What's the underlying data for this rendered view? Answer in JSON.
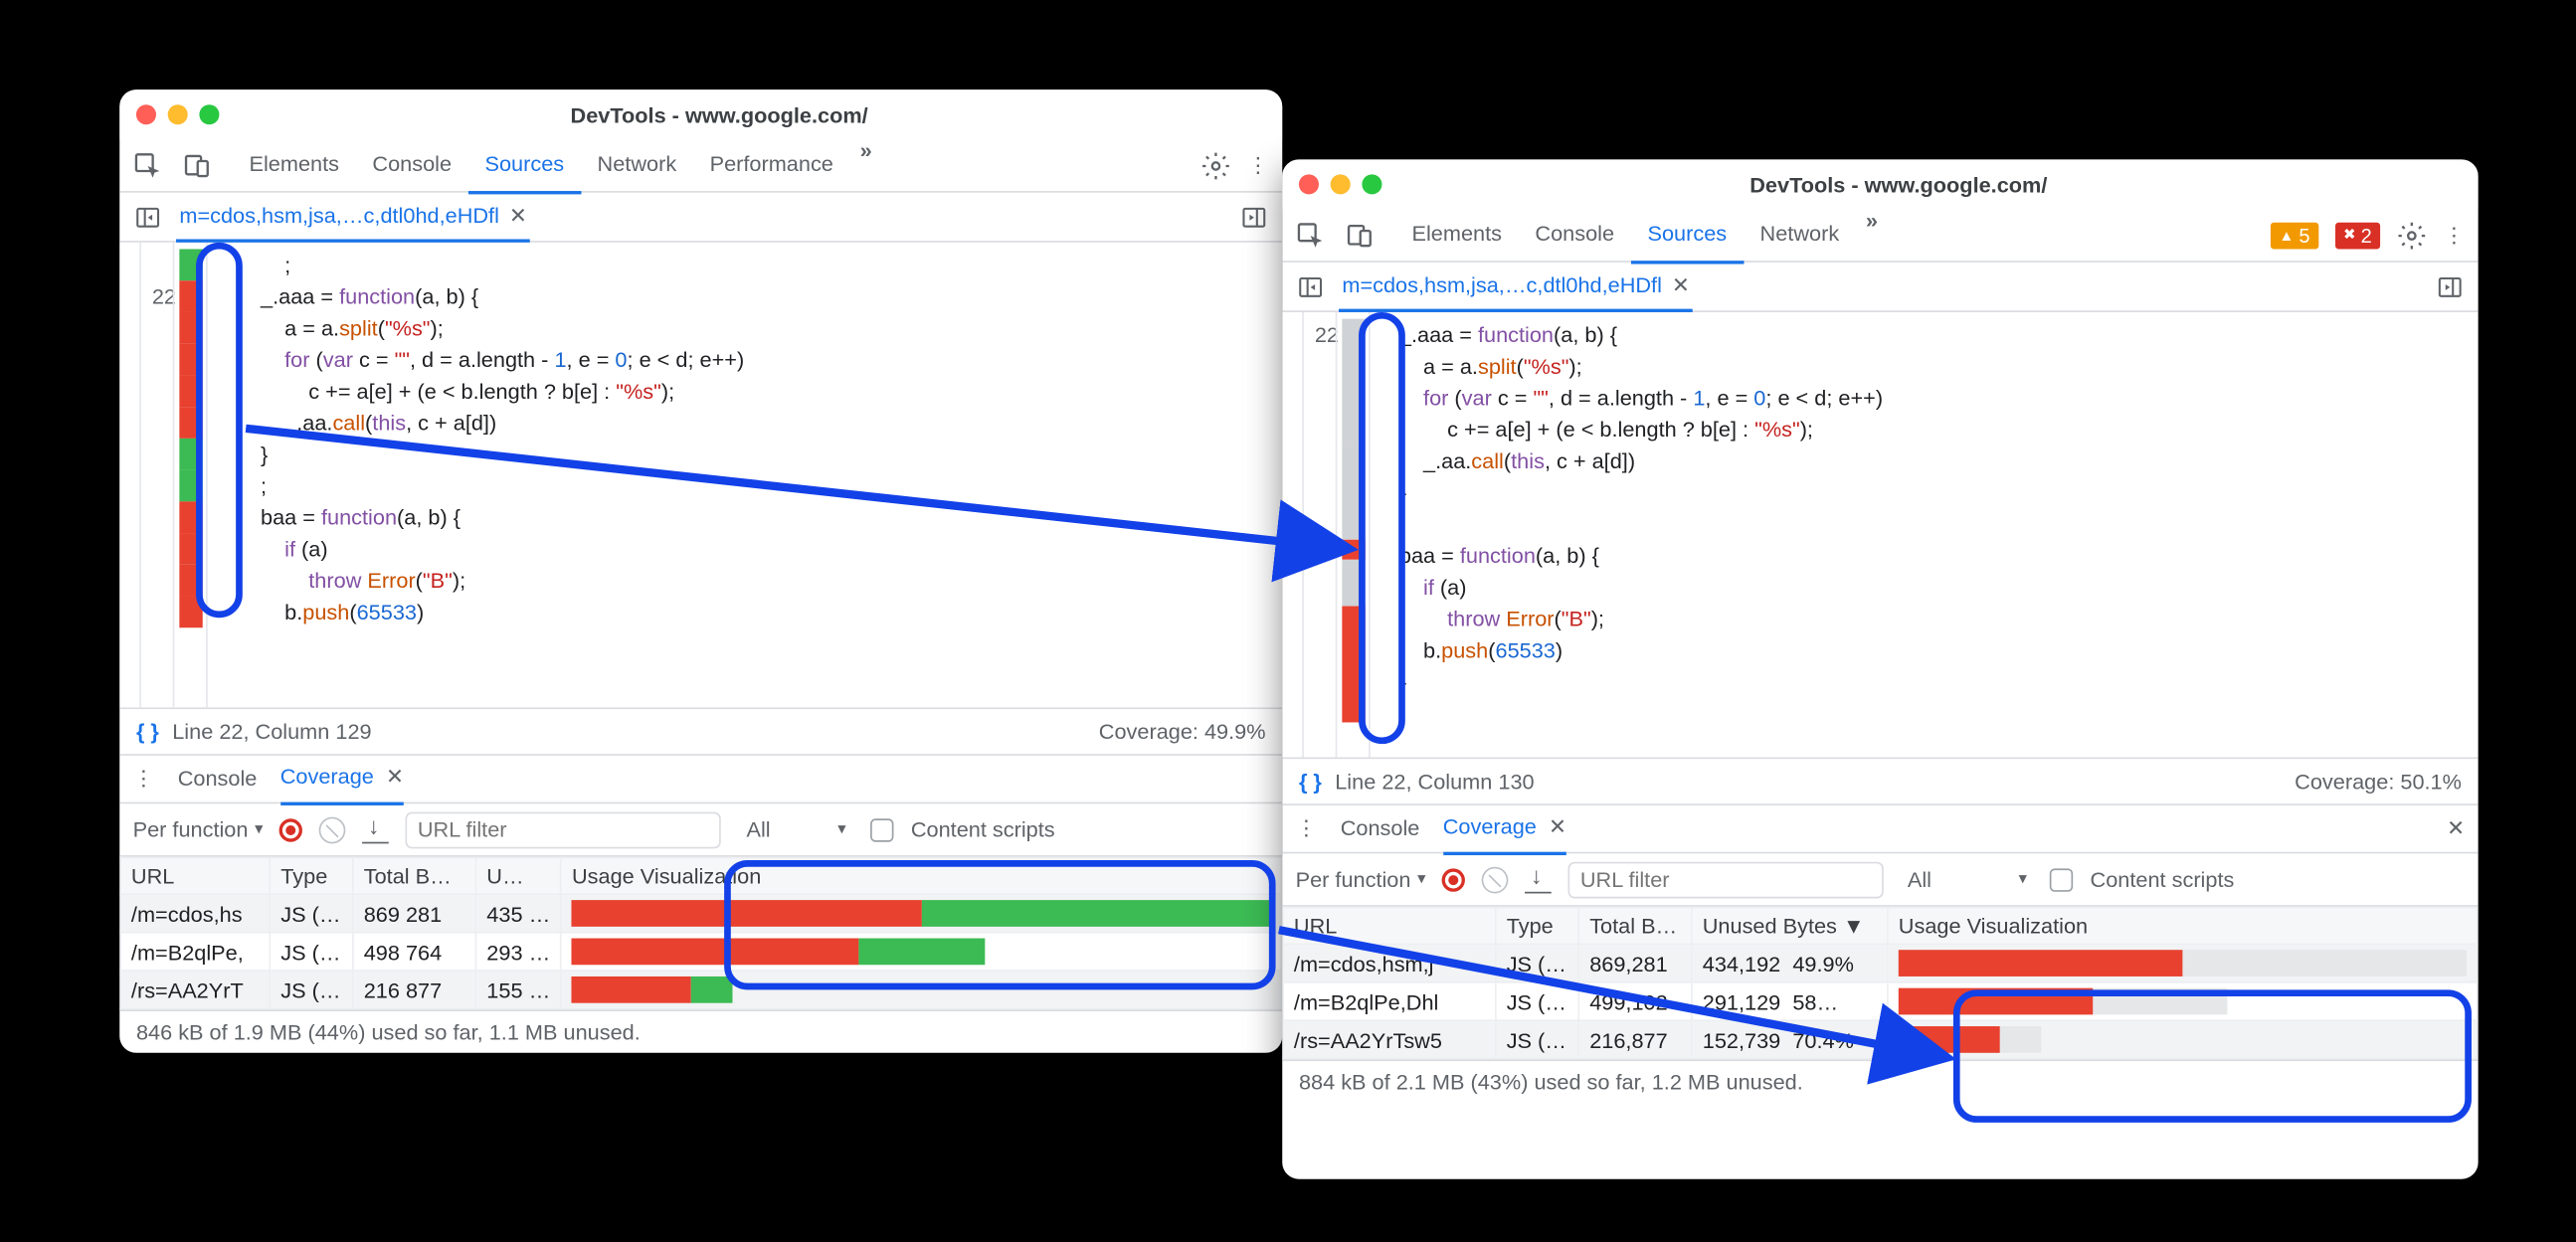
{
  "windows": {
    "w1": {
      "title": "DevTools - www.google.com/",
      "tabs": [
        "Elements",
        "Console",
        "Sources",
        "Network",
        "Performance"
      ],
      "active_tab": "Sources",
      "file_tab": "m=cdos,hsm,jsa,…c,dtl0hd,eHDfl",
      "line_number": "22",
      "status": {
        "pos": "Line 22, Column 129",
        "coverage": "Coverage: 49.9%"
      },
      "drawer": {
        "tabs": [
          "Console",
          "Coverage"
        ],
        "active": "Coverage",
        "mode": "Per function",
        "url_placeholder": "URL filter",
        "type_filter": "All",
        "content_scripts": "Content scripts",
        "headers": [
          "URL",
          "Type",
          "Total B…",
          "U…",
          "Usage Visualization"
        ],
        "rows": [
          {
            "url": "/m=cdos,hs",
            "type": "JS (…",
            "total": "869 281",
            "unused": "435 …",
            "red": 50,
            "green": 50,
            "bar": 100
          },
          {
            "url": "/m=B2qlPe,",
            "type": "JS (…",
            "total": "498 764",
            "unused": "293 …",
            "red": 41,
            "green": 18,
            "bar": 60
          },
          {
            "url": "/rs=AA2YrT",
            "type": "JS (…",
            "total": "216 877",
            "unused": "155 …",
            "red": 17,
            "green": 6,
            "bar": 23
          }
        ],
        "footer": "846 kB of 1.9 MB (44%) used so far, 1.1 MB unused."
      }
    },
    "w2": {
      "title": "DevTools - www.google.com/",
      "tabs": [
        "Elements",
        "Console",
        "Sources",
        "Network"
      ],
      "active_tab": "Sources",
      "warn_count": "5",
      "err_count": "2",
      "file_tab": "m=cdos,hsm,jsa,…c,dtl0hd,eHDfl",
      "line_number": "22",
      "status": {
        "pos": "Line 22, Column 130",
        "coverage": "Coverage: 50.1%"
      },
      "drawer": {
        "tabs": [
          "Console",
          "Coverage"
        ],
        "active": "Coverage",
        "mode": "Per function",
        "url_placeholder": "URL filter",
        "type_filter": "All",
        "content_scripts": "Content scripts",
        "headers": [
          "URL",
          "Type",
          "Total B…",
          "Unused Bytes ▼",
          "Usage Visualization"
        ],
        "rows": [
          {
            "url": "/m=cdos,hsm,j",
            "type": "JS (…",
            "total": "869,281",
            "unused": "434,192",
            "pct": "49.9%",
            "red": 50,
            "bar": 100
          },
          {
            "url": "/m=B2qlPe,Dhl",
            "type": "JS (…",
            "total": "499,102",
            "unused": "291,129",
            "pct": "58…",
            "red": 34,
            "bar": 58
          },
          {
            "url": "/rs=AA2YrTsw5",
            "type": "JS (…",
            "total": "216,877",
            "unused": "152,739",
            "pct": "70.4%",
            "red": 18,
            "bar": 25
          }
        ],
        "footer": "884 kB of 2.1 MB (43%) used so far, 1.2 MB unused."
      }
    }
  }
}
